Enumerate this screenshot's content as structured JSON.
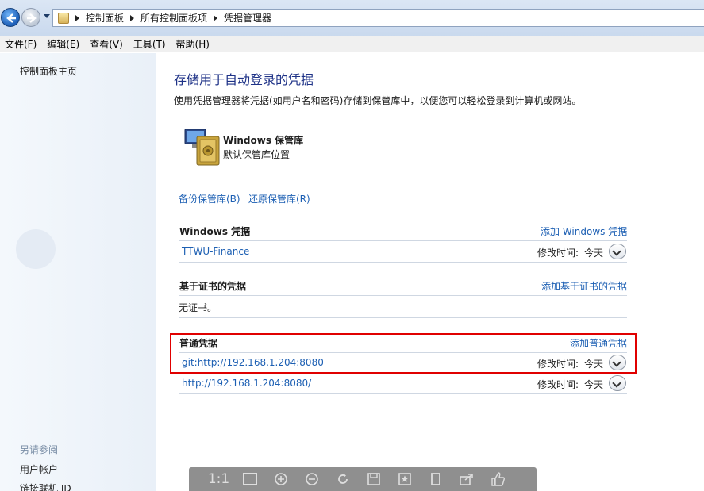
{
  "address": {
    "crumbs": [
      "控制面板",
      "所有控制面板项",
      "凭据管理器"
    ]
  },
  "menu": [
    "文件(F)",
    "编辑(E)",
    "查看(V)",
    "工具(T)",
    "帮助(H)"
  ],
  "sidebar": {
    "home": "控制面板主页",
    "see_also": "另请参阅",
    "links": [
      "用户帐户",
      "链接联机 ID"
    ]
  },
  "main": {
    "title": "存储用于自动登录的凭据",
    "description": "使用凭据管理器将凭据(如用户名和密码)存储到保管库中，以便您可以轻松登录到计算机或网站。",
    "vault_name": "Windows 保管库",
    "vault_desc": "默认保管库位置",
    "backup_link": "备份保管库(B)",
    "restore_link": "还原保管库(R)"
  },
  "sections": {
    "windows": {
      "title": "Windows 凭据",
      "add_link": "添加 Windows 凭据",
      "items": [
        {
          "name": "TTWU-Finance",
          "mod_label": "修改时间:",
          "mod_value": "今天"
        }
      ]
    },
    "cert": {
      "title": "基于证书的凭据",
      "add_link": "添加基于证书的凭据",
      "empty_text": "无证书。"
    },
    "generic": {
      "title": "普通凭据",
      "add_link": "添加普通凭据",
      "items": [
        {
          "name": "git:http://192.168.1.204:8080",
          "mod_label": "修改时间:",
          "mod_value": "今天"
        },
        {
          "name": "http://192.168.1.204:8080/",
          "mod_label": "修改时间:",
          "mod_value": "今天"
        }
      ]
    }
  },
  "viewer": {
    "actual_size": "1:1"
  },
  "colors": {
    "link": "#1c5fb3",
    "title": "#1e3287",
    "highlight": "#e00000"
  }
}
